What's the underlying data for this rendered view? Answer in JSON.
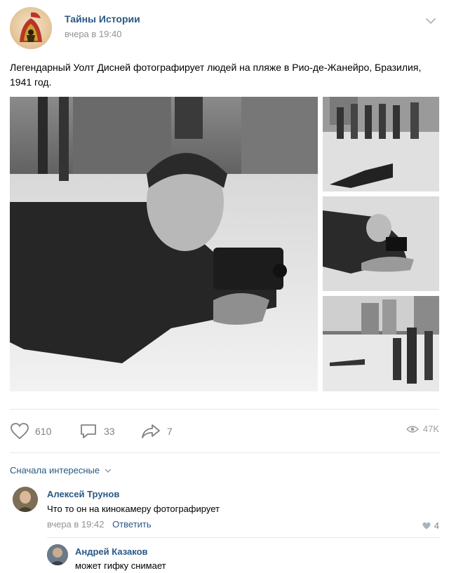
{
  "post": {
    "group_name": "Тайны Истории",
    "time": "вчера в 19:40",
    "text": "Легендарный Уолт Дисней фотографирует людей на пляже в Рио-де-Жанейро, Бразилия, 1941 год.",
    "photo_icons": [
      "photo-main",
      "photo-crowd",
      "photo-lying",
      "photo-camera-closeup",
      "photo-beach-buildings"
    ]
  },
  "actions": {
    "likes": "610",
    "comments": "33",
    "shares": "7",
    "views": "47K"
  },
  "comments_sort": "Сначала интересные",
  "comments": [
    {
      "author": "Алексей Трунов",
      "text": "Что то он на кинокамеру фотографирует",
      "time": "вчера в 19:42",
      "reply": "Ответить",
      "likes": "4"
    },
    {
      "author": "Андрей Казаков",
      "text": "может гифку снимает"
    }
  ],
  "colors": {
    "link": "#2a5885",
    "muted": "#939393",
    "icon": "#828282"
  }
}
